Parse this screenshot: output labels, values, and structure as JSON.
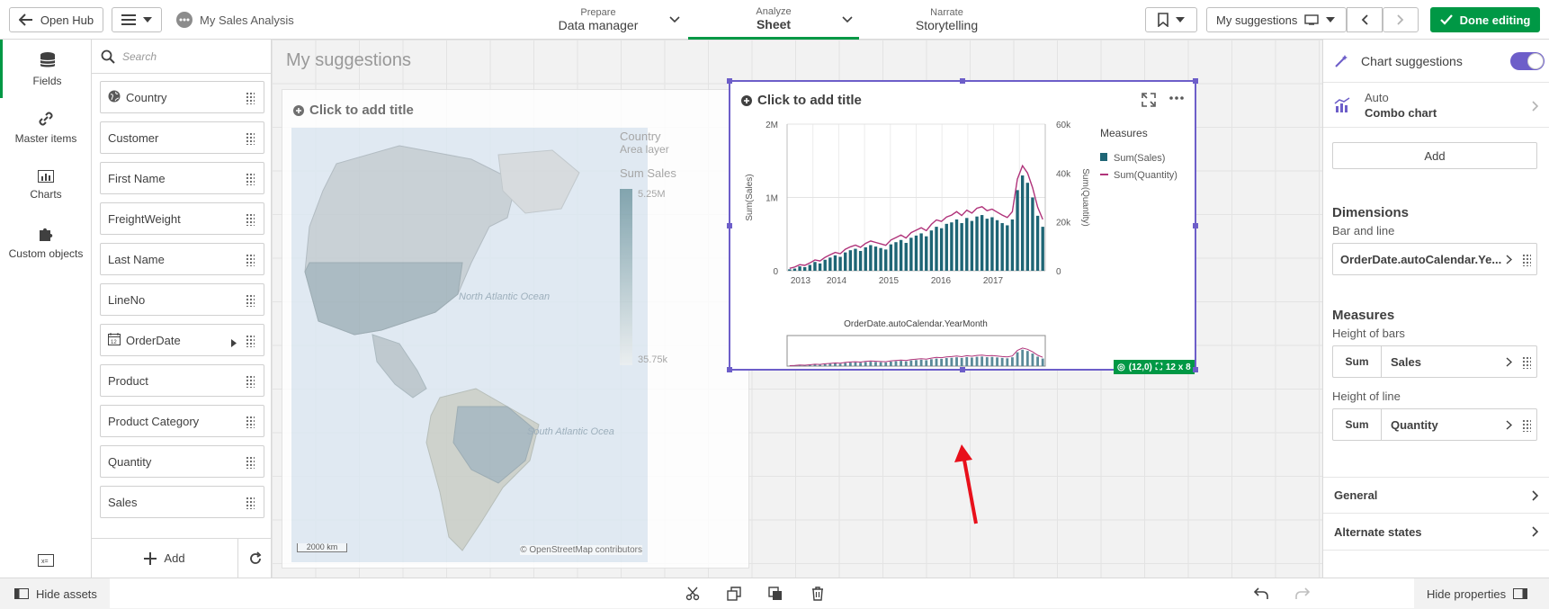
{
  "topbar": {
    "open_hub": "Open Hub",
    "app_name": "My Sales Analysis",
    "prepare_small": "Prepare",
    "prepare_big": "Data manager",
    "analyze_small": "Analyze",
    "analyze_big": "Sheet",
    "narrate_small": "Narrate",
    "narrate_big": "Storytelling",
    "sheet_selector": "My suggestions",
    "done_editing": "Done editing"
  },
  "leftrail": {
    "items": [
      {
        "label": "Fields",
        "icon": "database-icon"
      },
      {
        "label": "Master items",
        "icon": "link-icon"
      },
      {
        "label": "Charts",
        "icon": "bar-chart-icon"
      },
      {
        "label": "Custom objects",
        "icon": "puzzle-icon"
      }
    ]
  },
  "fieldpanel": {
    "search_placeholder": "Search",
    "fields": [
      "Country",
      "Customer",
      "First Name",
      "FreightWeight",
      "Last Name",
      "LineNo",
      "OrderDate",
      "Product",
      "Product Category",
      "Quantity",
      "Sales"
    ],
    "add_label": "Add"
  },
  "sheet": {
    "title": "My suggestions",
    "map_card": {
      "title": "Click to add title",
      "legend_title": "Country",
      "legend_sub": "Area layer",
      "legend_measure": "Sum Sales",
      "legend_max": "5.25M",
      "legend_min": "35.75k",
      "ocean_north": "North Atlantic Ocean",
      "ocean_south": "South Atlantic Ocea",
      "scale": "2000 km",
      "attribution": "© OpenStreetMap contributors"
    },
    "combo_card": {
      "title": "Click to add title",
      "badge_pos": "(12,0)",
      "badge_size": "12 x 8"
    }
  },
  "chart_data": {
    "type": "bar",
    "title": "Click to add title",
    "xlabel": "OrderDate.autoCalendar.YearMonth",
    "ylabel": "Sum(Sales)",
    "y2label": "Sum(Quantity)",
    "legend_title": "Measures",
    "x_ticks": [
      "2013",
      "2014",
      "2015",
      "2016",
      "2017"
    ],
    "y_ticks": [
      "0",
      "1M",
      "2M"
    ],
    "y2_ticks": [
      "0",
      "20k",
      "40k",
      "60k"
    ],
    "ylim": [
      0,
      2000000
    ],
    "y2lim": [
      0,
      60000
    ],
    "series": [
      {
        "name": "Sum(Sales)",
        "type": "bar",
        "color": "#1e6575",
        "values": [
          20000,
          30000,
          60000,
          50000,
          80000,
          120000,
          100000,
          150000,
          180000,
          210000,
          190000,
          250000,
          280000,
          300000,
          270000,
          320000,
          350000,
          330000,
          310000,
          290000,
          360000,
          390000,
          420000,
          380000,
          450000,
          480000,
          510000,
          470000,
          550000,
          600000,
          580000,
          640000,
          660000,
          700000,
          650000,
          720000,
          680000,
          740000,
          760000,
          710000,
          730000,
          690000,
          650000,
          620000,
          700000,
          1100000,
          1300000,
          1200000,
          1000000,
          750000,
          600000
        ]
      },
      {
        "name": "Sum(Quantity)",
        "type": "line",
        "color": "#b0337a",
        "values": [
          1000,
          1500,
          2500,
          2200,
          3200,
          4400,
          4000,
          5500,
          6500,
          7500,
          7000,
          8800,
          9800,
          10500,
          9600,
          11200,
          12200,
          11600,
          11000,
          10400,
          12600,
          13600,
          14600,
          13400,
          15600,
          16600,
          17600,
          16400,
          19000,
          20800,
          20200,
          22000,
          22800,
          24200,
          22600,
          24800,
          23600,
          25600,
          26200,
          24600,
          25200,
          24000,
          22800,
          21800,
          24200,
          37500,
          43000,
          40000,
          34000,
          26000,
          21000
        ]
      }
    ]
  },
  "rightpanel": {
    "chart_suggestions": "Chart suggestions",
    "auto_label": "Auto",
    "chart_type": "Combo chart",
    "add_label": "Add",
    "dimensions_header": "Dimensions",
    "dimensions_sub": "Bar and line",
    "dimension_field": "OrderDate.autoCalendar.Ye...",
    "measures_header": "Measures",
    "height_bars": "Height of bars",
    "agg1": "Sum",
    "measure1": "Sales",
    "height_line": "Height of line",
    "agg2": "Sum",
    "measure2": "Quantity",
    "general": "General",
    "alternate_states": "Alternate states"
  },
  "bottombar": {
    "hide_assets": "Hide assets",
    "hide_properties": "Hide properties"
  }
}
